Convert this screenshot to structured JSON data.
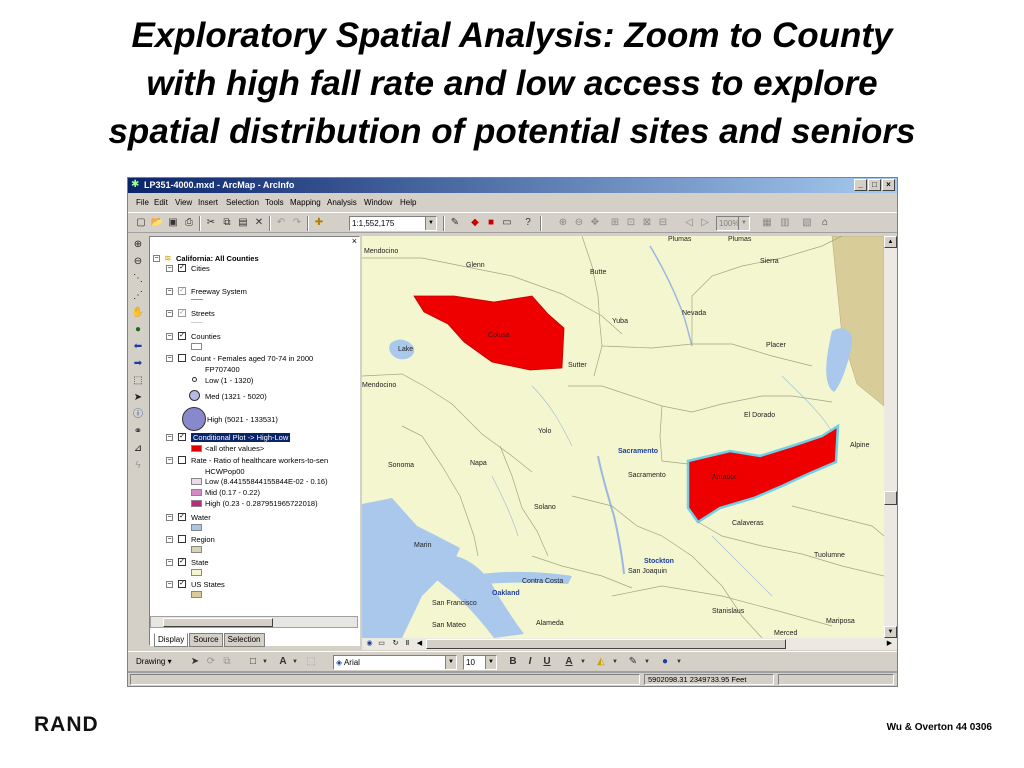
{
  "slide": {
    "title_lines": [
      "Exploratory Spatial Analysis:  Zoom to County",
      "with high fall rate and low access to explore",
      "spatial distribution of potential sites and seniors"
    ],
    "logo_text": "RAND",
    "footer": "Wu & Overton 44  0306"
  },
  "window": {
    "title": "LP351-4000.mxd - ArcMap - ArcInfo",
    "controls": [
      "_",
      "□",
      "×"
    ]
  },
  "menu": [
    "File",
    "Edit",
    "View",
    "Insert",
    "Selection",
    "Tools",
    "Mapping",
    "Analysis",
    "Window",
    "Help"
  ],
  "toolbar": {
    "scale_value": "1:1,552,175",
    "zoom_percent": "100%"
  },
  "toc": {
    "root": "California:  All Counties",
    "layers": {
      "cities": "Cities",
      "freeway": "Freeway System",
      "streets": "Streets",
      "counties": "Counties",
      "count_females": "Count - Females aged 70-74 in 2000",
      "fp_field": "FP707400",
      "low": "Low (1 - 1320)",
      "med": "Med (1321 - 5020)",
      "high": "High (5021 - 133531)",
      "conditional_plot": "Conditional Plot -> High-Low",
      "other_values": "<all other values>",
      "rate": "Rate - Ratio of healthcare workers-to-sen",
      "hcw_field": "HCWPop00",
      "rate_low": "Low (8.44155844155844E-02 - 0.16)",
      "rate_mid": "Mid (0.17 - 0.22)",
      "rate_high": "High (0.23 - 0.287951965722018)",
      "water": "Water",
      "region": "Region",
      "state": "State",
      "us_states": "US States"
    },
    "tabs": [
      "Display",
      "Source",
      "Selection"
    ]
  },
  "map": {
    "labels": {
      "mendocino_top": "Mendocino",
      "glenn": "Glenn",
      "butte": "Butte",
      "plumas1": "Plumas",
      "plumas2": "Plumas",
      "sierra": "Sierra",
      "colusa": "Colusa",
      "yuba": "Yuba",
      "nevada": "Nevada",
      "lake": "Lake",
      "sutter": "Sutter",
      "placer": "Placer",
      "mendocino_mid": "Mendocino",
      "el_dorado": "El Dorado",
      "yolo": "Yolo",
      "sacramento_city": "Sacramento",
      "alpine": "Alpine",
      "sonoma": "Sonoma",
      "napa": "Napa",
      "sacramento_county": "Sacramento",
      "amador": "Amador",
      "solano": "Solano",
      "calaveras": "Calaveras",
      "marin": "Marin",
      "stockton": "Stockton",
      "san_joaquin": "San Joaquin",
      "tuolumne": "Tuolumne",
      "contra_costa": "Contra Costa",
      "oakland": "Oakland",
      "san_francisco": "San Francisco",
      "stanislaus": "Stanislaus",
      "mariposa": "Mariposa",
      "san_mateo": "San Mateo",
      "alameda": "Alameda",
      "merced": "Merced"
    }
  },
  "drawing": {
    "label": "Drawing",
    "font": "Arial",
    "size": "10",
    "bold": "B",
    "italic": "I",
    "underline": "U",
    "text_tool": "A"
  },
  "status": {
    "coordinates": "5902098.31  2349733.95 Feet"
  }
}
